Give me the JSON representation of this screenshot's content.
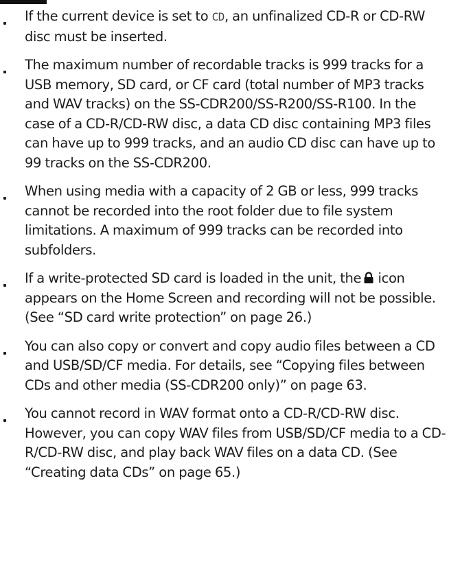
{
  "lcd_cd_label": "CD",
  "notes": [
    {
      "before": "If the current device is set to ",
      "after": ", an unfinalized CD-R or CD-RW disc must be inserted."
    },
    {
      "text": "The maximum number of recordable tracks is 999 tracks for a USB memory, SD card, or CF card (total number of MP3 tracks and WAV tracks) on the SS-CDR200/SS-R200/SS-R100. In the case of a CD-R/CD-RW disc, a data CD disc containing MP3 files can have up to 999 tracks, and an audio CD disc can have up to 99 tracks on the SS-CDR200."
    },
    {
      "text": "When using media with a capacity of 2 GB or less, 999 tracks cannot be recorded into the root folder due to file system limitations. A maximum of 999 tracks can be recorded into subfolders."
    },
    {
      "before": "If a write-protected SD card is loaded in the unit, the",
      "after": " icon appears on the Home Screen and recording will not be possible. (See “SD card write protection” on page 26.)",
      "icon": "lock-icon"
    },
    {
      "text": "You can also copy or convert and copy audio files between a CD and USB/SD/CF media. For details, see “Copying files between CDs and other media (SS-CDR200 only)” on page 63."
    },
    {
      "text": "You cannot record in WAV format onto a CD-R/CD-RW disc. However, you can copy WAV files from USB/SD/CF media to a CD-R/CD-RW disc, and play back WAV files on a data CD. (See “Creating data CDs” on page 65.)"
    }
  ]
}
